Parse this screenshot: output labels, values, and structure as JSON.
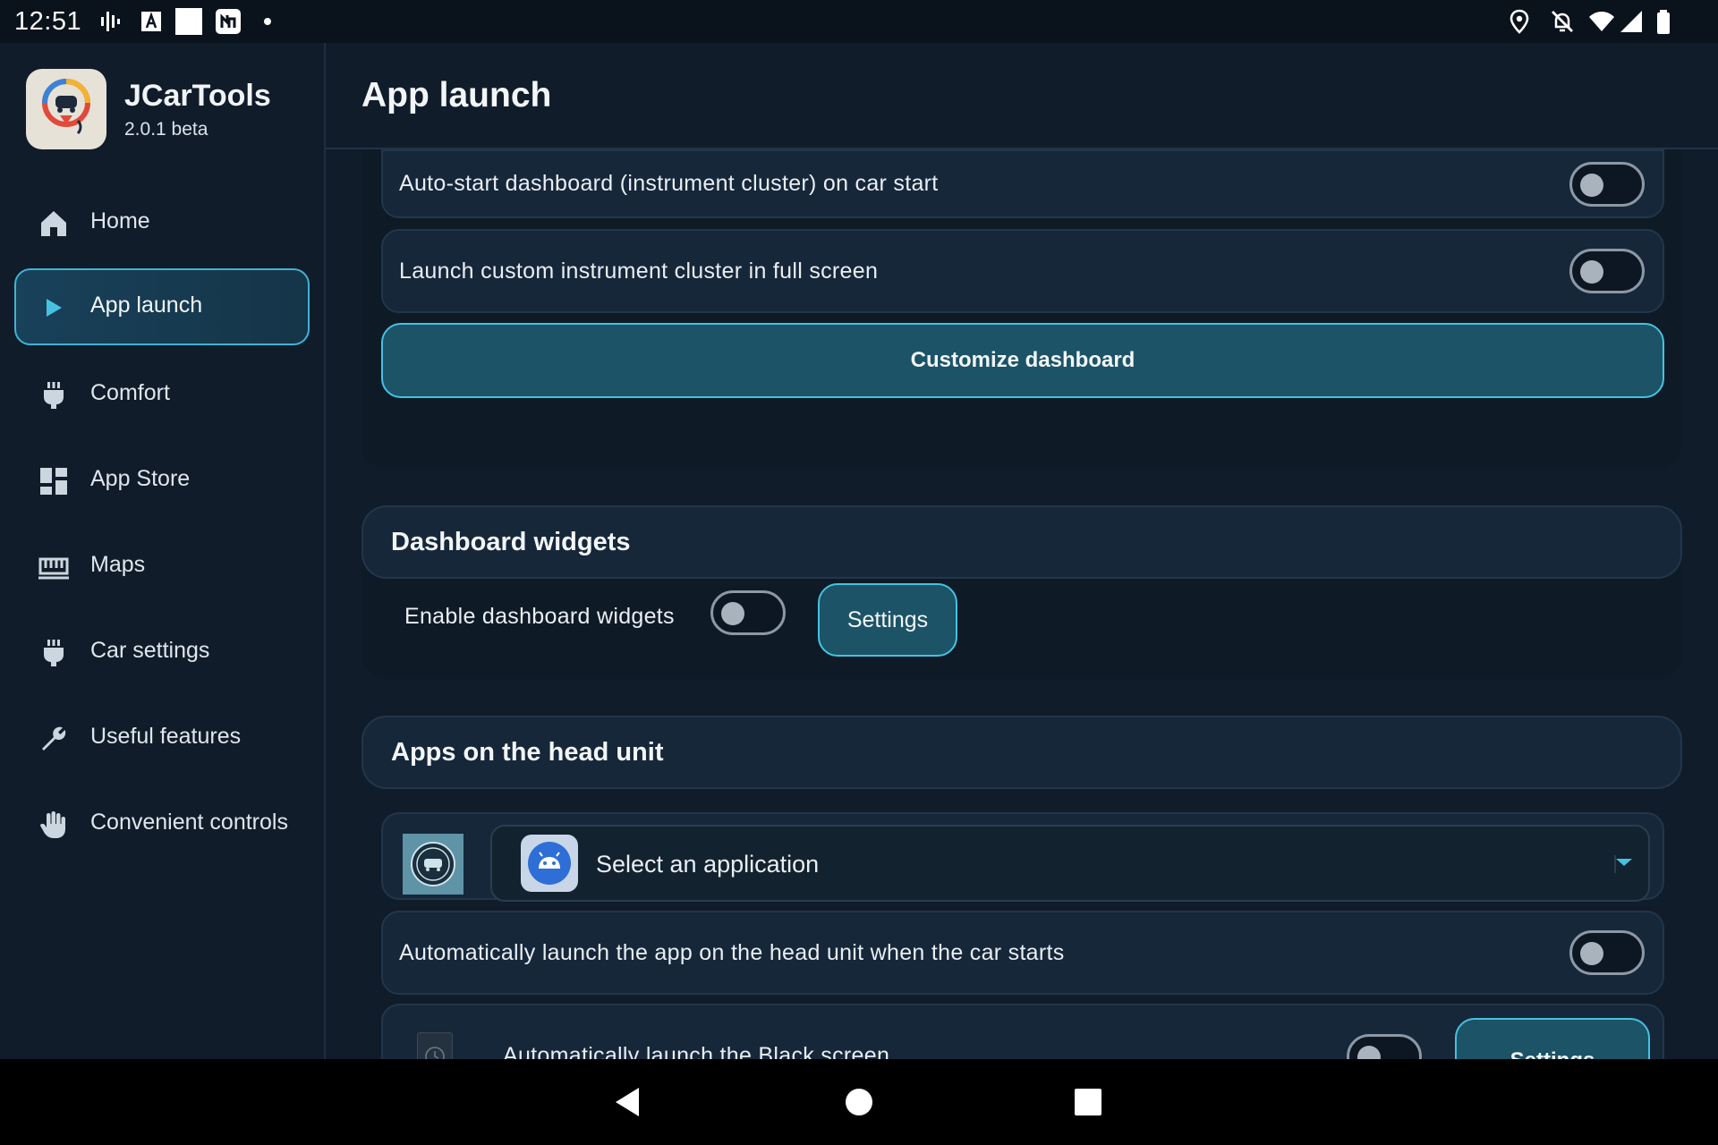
{
  "status_bar": {
    "time": "12:51",
    "left_icons": [
      "signal-bars-icon",
      "font-a-icon",
      "white-square-icon",
      "news-icon",
      "dot-icon"
    ],
    "right_icons": [
      "location-icon",
      "notifications-off-icon",
      "wifi-icon",
      "cell-signal-icon",
      "battery-icon"
    ]
  },
  "sidebar": {
    "app_name": "JCarTools",
    "app_version": "2.0.1 beta",
    "items": [
      {
        "label": "Home",
        "icon": "home-icon",
        "active": false
      },
      {
        "label": "App launch",
        "icon": "play-icon",
        "active": true
      },
      {
        "label": "Comfort",
        "icon": "plug-icon",
        "active": false
      },
      {
        "label": "App Store",
        "icon": "dashboard-grid-icon",
        "active": false
      },
      {
        "label": "Maps",
        "icon": "map-ruler-icon",
        "active": false
      },
      {
        "label": "Car settings",
        "icon": "plug-icon",
        "active": false
      },
      {
        "label": "Useful features",
        "icon": "wrench-icon",
        "active": false
      },
      {
        "label": "Convenient controls",
        "icon": "hand-icon",
        "active": false
      }
    ]
  },
  "header": {
    "title": "App launch"
  },
  "dashboard_card": {
    "autostart_label": "Auto-start dashboard (instrument cluster) on car start",
    "autostart_on": false,
    "fullscreen_label": "Launch custom instrument cluster in full screen",
    "fullscreen_on": false,
    "customize_button": "Customize dashboard"
  },
  "widgets_section": {
    "title": "Dashboard widgets",
    "enable_label": "Enable dashboard widgets",
    "enable_on": false,
    "settings_button": "Settings"
  },
  "apps_section": {
    "title": "Apps on the head unit",
    "select_placeholder": "Select an application",
    "auto_launch_label": "Automatically launch the app on the head unit when the car starts",
    "auto_launch_on": false,
    "black_screen_label": "Automatically launch the Black screen",
    "black_screen_on": false,
    "black_screen_settings": "Settings"
  },
  "colors": {
    "background": "#111c2a",
    "accent": "#46c2e0",
    "button_fill": "#1c5366",
    "card": "#16273a"
  }
}
